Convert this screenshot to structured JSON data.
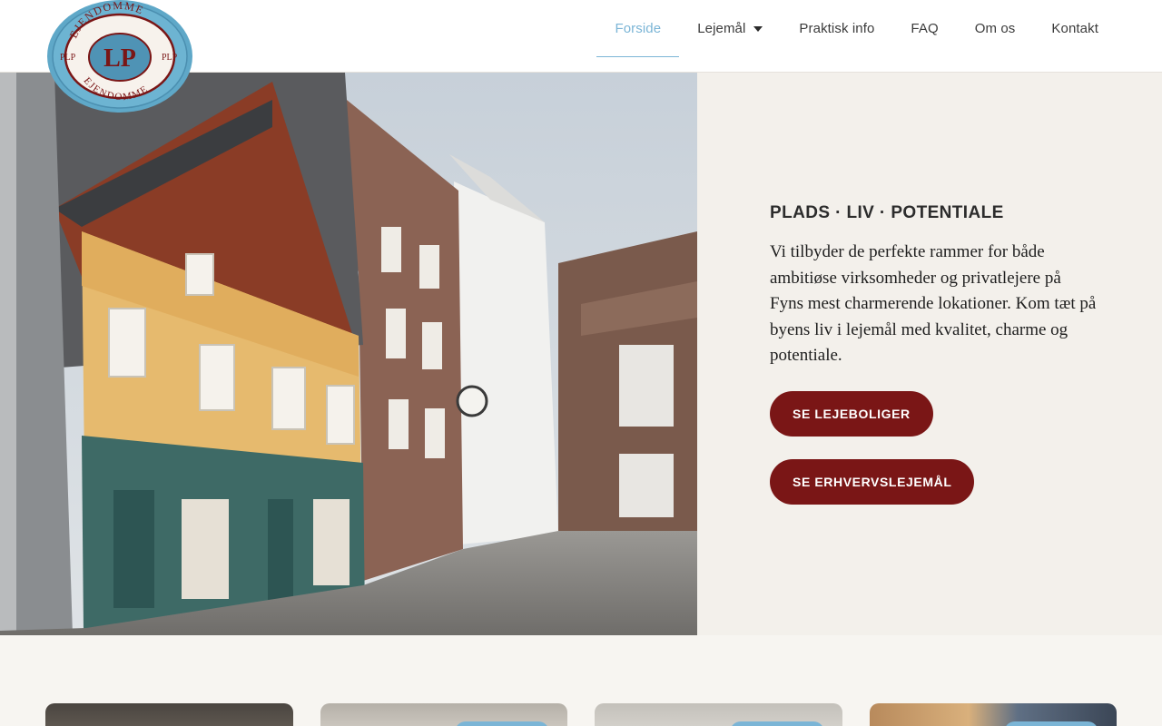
{
  "logo": {
    "text_top": "EJENDOMME",
    "text_side": "PLP",
    "monogram": "PLP",
    "border_color": "#5fa8c8",
    "accent": "#7a1616"
  },
  "nav": {
    "items": [
      {
        "label": "Forside",
        "active": true
      },
      {
        "label": "Lejemål",
        "has_dropdown": true
      },
      {
        "label": "Praktisk info"
      },
      {
        "label": "FAQ"
      },
      {
        "label": "Om os"
      },
      {
        "label": "Kontakt"
      }
    ],
    "active_color": "#7bb5d6",
    "dropdown_icon": "caret-down-icon"
  },
  "hero": {
    "tagline": "PLADS · LIV · POTENTIALE",
    "description": "Vi tilbyder de perfekte rammer for både ambitiøse virksomheder og privatlejere på Fyns mest charmerende lokationer. Kom tæt på byens liv i lejemål med kvalitet, charme og potentiale.",
    "buttons": [
      {
        "label": "SE LEJEBOLIGER"
      },
      {
        "label": "SE ERHVERVSLEJEMÅL"
      }
    ],
    "button_color": "#7a1616",
    "panel_color": "#f3f0eb"
  },
  "cards": {
    "count": 4,
    "badge_color": "#7bb5d6"
  }
}
